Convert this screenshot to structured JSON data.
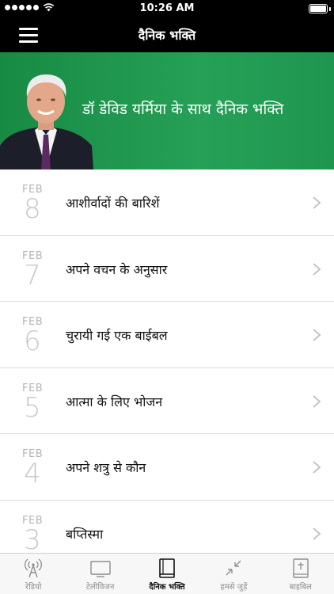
{
  "status_bar": {
    "time": "10:26 AM"
  },
  "nav": {
    "title": "दैनिक भक्ति"
  },
  "banner": {
    "text": "डॉ डेविड यर्मिया के साथ दैनिक भक्ति"
  },
  "devotionals": [
    {
      "month": "FEB",
      "day": "8",
      "title": "आशीर्वादों की बारिशें"
    },
    {
      "month": "FEB",
      "day": "7",
      "title": "अपने वचन के अनुसार"
    },
    {
      "month": "FEB",
      "day": "6",
      "title": "चुरायी गई एक बाईबल"
    },
    {
      "month": "FEB",
      "day": "5",
      "title": "आत्मा के लिए भोजन"
    },
    {
      "month": "FEB",
      "day": "4",
      "title": "अपने शत्रु से कौन"
    },
    {
      "month": "FEB",
      "day": "3",
      "title": "बप्तिस्मा"
    }
  ],
  "tabs": [
    {
      "label": "रेडियो",
      "icon": "radio-tower-icon",
      "active": false
    },
    {
      "label": "टेलीविजन",
      "icon": "tv-icon",
      "active": false
    },
    {
      "label": "दैनिक भक्ति",
      "icon": "book-icon",
      "active": true
    },
    {
      "label": "हमसे जुड़ें",
      "icon": "connect-arrows-icon",
      "active": false
    },
    {
      "label": "बाइबिल",
      "icon": "bible-icon",
      "active": false
    }
  ],
  "colors": {
    "banner_green": "#26a057",
    "bar_black": "#000000"
  }
}
